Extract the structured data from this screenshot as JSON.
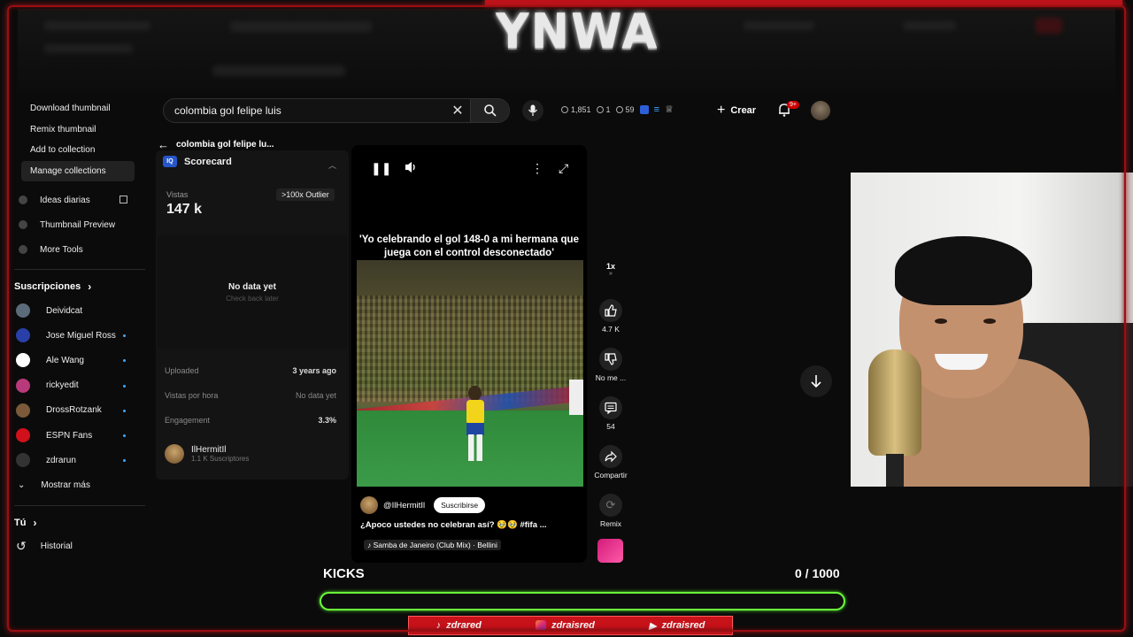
{
  "overlay": {
    "banner": "YNWA"
  },
  "search": {
    "query": "colombia gol felipe luis"
  },
  "header_stats": {
    "views": "1,851",
    "likes": "1",
    "comments": "59",
    "create_label": "Crear",
    "notif_badge": "9+"
  },
  "context_menu": {
    "items": [
      "Download thumbnail",
      "Remix thumbnail",
      "Add to collection",
      "Manage collections"
    ]
  },
  "sidebar": {
    "tools": [
      "Ideas diarias",
      "Thumbnail Preview",
      "More Tools"
    ],
    "subs_header": "Suscripciones",
    "subscriptions": [
      "Deividcat",
      "Jose Miguel Ross",
      "Ale Wang",
      "rickyedit",
      "DrossRotzank",
      "ESPN Fans",
      "zdrarun"
    ],
    "show_more": "Mostrar más",
    "you_header": "Tú",
    "history": "Historial"
  },
  "scorecard": {
    "breadcrumb": "colombia gol felipe lu...",
    "title": "Scorecard",
    "views_label": "Vistas",
    "views_value": "147 k",
    "outlier": ">100x Outlier",
    "nodata_title": "No data yet",
    "nodata_sub": "Check back later",
    "uploaded_label": "Uploaded",
    "uploaded_value": "3 years ago",
    "vph_label": "Vistas por hora",
    "vph_value": "No data yet",
    "engagement_label": "Engagement",
    "engagement_value": "3.3%",
    "channel_name": "IlHermitIl",
    "channel_subs": "1.1 K Suscriptores"
  },
  "video": {
    "caption": "'Yo celebrando el gol 148-0 a mi hermana que juega con el control desconectado'",
    "channel": "@IlHermitIl",
    "subscribe": "Suscribirse",
    "description": "¿Apoco ustedes no celebran así? 🥹🥹 #fifa ...",
    "music": "♪ Samba de Janeiro (Club Mix) · Bellini"
  },
  "actions": {
    "speed": "1x",
    "likes": "4.7 K",
    "dislike": "No me ...",
    "comments": "54",
    "share": "Compartir",
    "remix": "Remix"
  },
  "kicks": {
    "label": "KICKS",
    "count": "0 / 1000",
    "progress": 0
  },
  "socials": [
    "zdrared",
    "zdraisred",
    "zdraisred"
  ],
  "colors": {
    "frame": "#9b0f12",
    "accent_green": "#6cff3a",
    "social_red": "#c8121a",
    "yt_blue": "#3ea6ff"
  }
}
